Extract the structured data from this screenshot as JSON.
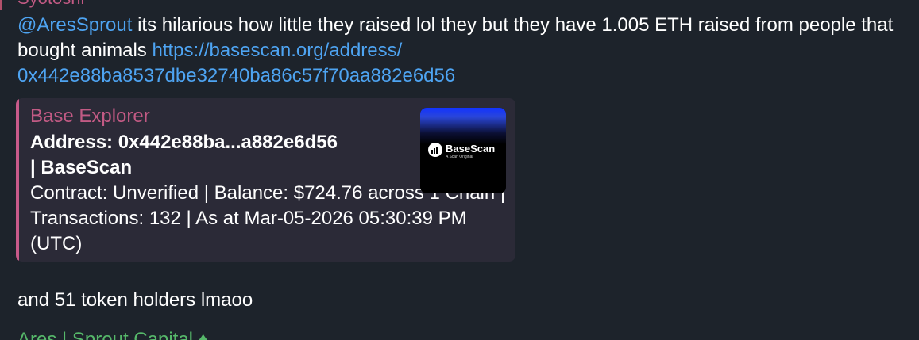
{
  "message": {
    "sender_cut": "Syotoshi",
    "mention": "@AresSprout",
    "text_before_link": " its hilarious how little they raised lol they but they have 1.005 ETH raised from people that bought animals ",
    "link_line1": "https://basescan.org/address/",
    "link_line2": "0x442e88ba8537dbe32740ba86c57f70aa882e6d56"
  },
  "preview": {
    "site_name": "Base Explorer",
    "title_line1": "Address: 0x442e88ba...a882e6d56",
    "title_line2": "| BaseScan",
    "description": "Contract: Unverified | Balance: $724.76 across 1 Chain | Transactions: 132 | As at Mar-05-2026 05:30:39 PM (UTC)",
    "thumbnail": {
      "logo_name": "BaseScan",
      "logo_tagline": "A Scan Original"
    }
  },
  "footer": {
    "text": "and 51 token holders lmaoo"
  },
  "next_message": {
    "sender_cut": "Ares | Sprout Capital ♦"
  },
  "colors": {
    "background": "#1d232b",
    "link": "#4ea4f2",
    "sender": "#c25a84",
    "preview_bg": "#2b2a37",
    "preview_accent": "#c85a8a",
    "next_sender": "#56b86a"
  }
}
